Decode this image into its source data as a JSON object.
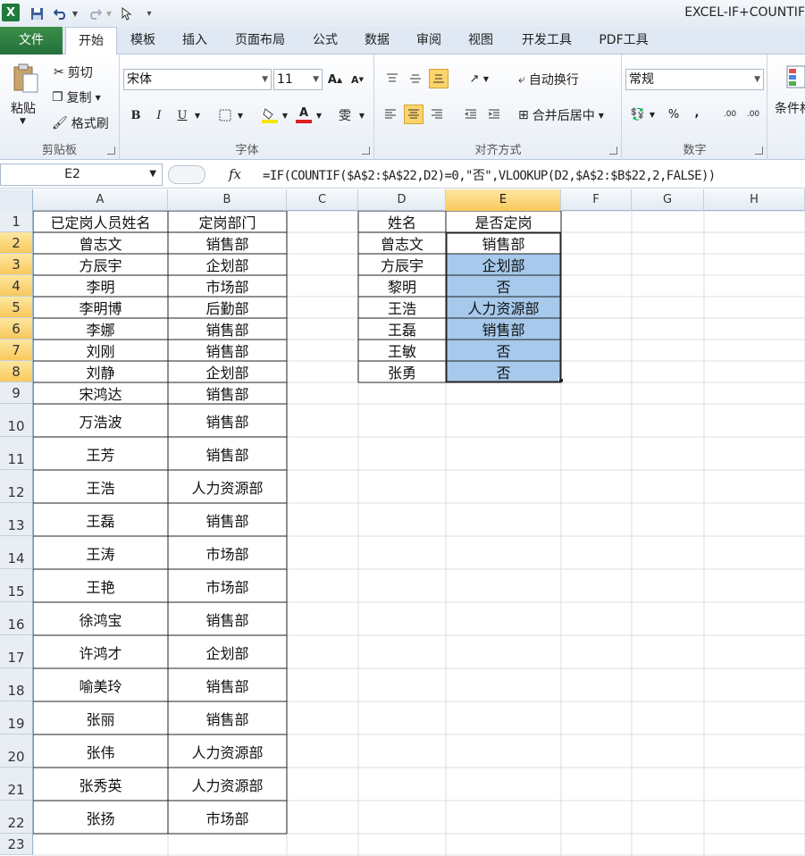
{
  "window": {
    "title": "EXCEL-IF+COUNTIF"
  },
  "quick_access": {
    "save_icon": "save-icon",
    "undo_icon": "undo-icon",
    "redo_icon": "redo-icon",
    "pointer_icon": "pointer-icon"
  },
  "tabs": [
    "文件",
    "开始",
    "模板",
    "插入",
    "页面布局",
    "公式",
    "数据",
    "审阅",
    "视图",
    "开发工具",
    "PDF工具"
  ],
  "ribbon": {
    "clipboard": {
      "paste": "粘贴",
      "cut": "剪切",
      "copy": "复制",
      "format_painter": "格式刷",
      "label": "剪贴板"
    },
    "font": {
      "name": "宋体",
      "size": "11",
      "bold": "B",
      "italic": "I",
      "underline": "U",
      "label": "字体"
    },
    "alignment": {
      "wrap": "自动换行",
      "merge": "合并后居中",
      "label": "对齐方式"
    },
    "number": {
      "format": "常规",
      "percent": "%",
      "comma": ",",
      "inc": ".00",
      "dec": ".00",
      "label": "数字"
    },
    "styles": {
      "cond": "条件格"
    }
  },
  "formula_bar": {
    "name_box": "E2",
    "fx": "fx",
    "formula": "=IF(COUNTIF($A$2:$A$22,D2)=0,\"否\",VLOOKUP(D2,$A$2:$B$22,2,FALSE))"
  },
  "columns": [
    "A",
    "B",
    "C",
    "D",
    "E",
    "F",
    "G",
    "H"
  ],
  "rows": [
    "1",
    "2",
    "3",
    "4",
    "5",
    "6",
    "7",
    "8",
    "9",
    "10",
    "11",
    "12",
    "13",
    "14",
    "15",
    "16",
    "17",
    "18",
    "19",
    "20",
    "21",
    "22",
    "23"
  ],
  "table1": {
    "headers": [
      "已定岗人员姓名",
      "定岗部门"
    ],
    "rows": [
      [
        "曾志文",
        "销售部"
      ],
      [
        "方辰宇",
        "企划部"
      ],
      [
        "李明",
        "市场部"
      ],
      [
        "李明博",
        "后勤部"
      ],
      [
        "李娜",
        "销售部"
      ],
      [
        "刘刚",
        "销售部"
      ],
      [
        "刘静",
        "企划部"
      ],
      [
        "宋鸿达",
        "销售部"
      ],
      [
        "万浩波",
        "销售部"
      ],
      [
        "王芳",
        "销售部"
      ],
      [
        "王浩",
        "人力资源部"
      ],
      [
        "王磊",
        "销售部"
      ],
      [
        "王涛",
        "市场部"
      ],
      [
        "王艳",
        "市场部"
      ],
      [
        "徐鸿宝",
        "销售部"
      ],
      [
        "许鸿才",
        "企划部"
      ],
      [
        "喻美玲",
        "销售部"
      ],
      [
        "张丽",
        "销售部"
      ],
      [
        "张伟",
        "人力资源部"
      ],
      [
        "张秀英",
        "人力资源部"
      ],
      [
        "张扬",
        "市场部"
      ]
    ]
  },
  "table2": {
    "headers": [
      "姓名",
      "是否定岗"
    ],
    "rows": [
      [
        "曾志文",
        "销售部"
      ],
      [
        "方辰宇",
        "企划部"
      ],
      [
        "黎明",
        "否"
      ],
      [
        "王浩",
        "人力资源部"
      ],
      [
        "王磊",
        "销售部"
      ],
      [
        "王敏",
        "否"
      ],
      [
        "张勇",
        "否"
      ]
    ]
  },
  "colors": {
    "selection": "#a6c9ec",
    "header_highlight": "#f8c95c",
    "file_tab": "#2e7d3f"
  }
}
